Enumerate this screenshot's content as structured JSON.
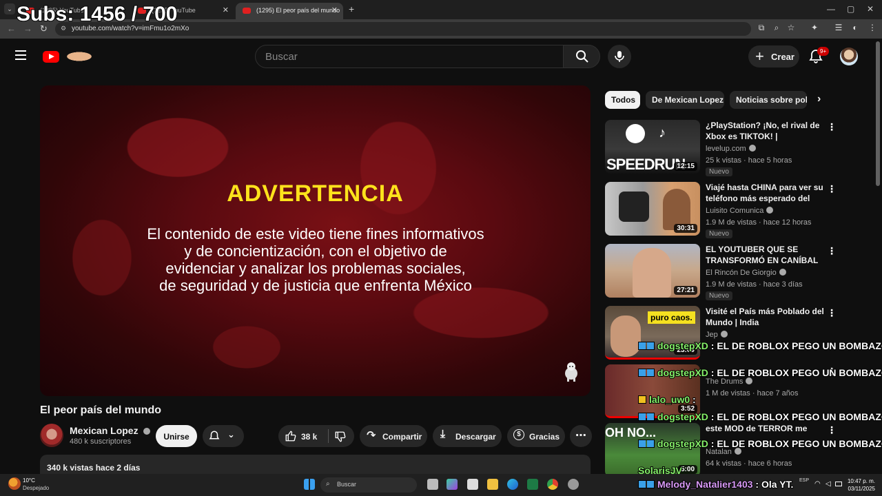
{
  "overlay": {
    "subs_counter": "Subs: 1456 / 700"
  },
  "browser": {
    "tabs": [
      {
        "label": "(1295) YouTube"
      },
      {
        "label": "(1295) YouTube"
      },
      {
        "label": "(1295) El peor país del mundo"
      }
    ],
    "new_tab": "+",
    "url": "youtube.com/watch?v=imFmu1o2mXo"
  },
  "header": {
    "search_placeholder": "Buscar",
    "create_label": "Crear",
    "notifications_badge": "9+"
  },
  "player": {
    "warning_title": "ADVERTENCIA",
    "warning_body": [
      "El contenido de este video tiene fines informativos",
      "y de concientización, con el objetivo de",
      "evidenciar y analizar los problemas sociales,",
      "de seguridad y de justicia que enfrenta México"
    ]
  },
  "video": {
    "title": "El peor país del mundo",
    "channel": "Mexican Lopez",
    "subscribers": "480 k suscriptores",
    "join_label": "Unirse",
    "likes": "38 k",
    "share_label": "Compartir",
    "download_label": "Descargar",
    "thanks_label": "Gracias",
    "views_date": "340 k vistas  hace 2 días"
  },
  "chips": [
    "Todos",
    "De Mexican Lopez",
    "Noticias sobre poli"
  ],
  "recommendations": [
    {
      "title": "¿PlayStation? ¡No, el rival de Xbox es TIKTOK! | SPEEDRUN",
      "channel": "levelup.com",
      "meta": "25 k vistas · hace 5 horas",
      "badge": "Nuevo",
      "duration": "12:15",
      "thumb_text": "SPEEDRUN"
    },
    {
      "title": "Viajé hasta CHINA para ver su teléfono más esperado del añ...",
      "channel": "Luisito Comunica",
      "meta": "1.9 M de vistas · hace 12 horas",
      "badge": "Nuevo",
      "duration": "30:31",
      "thumb_text": ""
    },
    {
      "title": "EL YOUTUBER QUE SE TRANSFORMÓ EN CANÍBAL ...",
      "channel": "El Rincón De Giorgio",
      "meta": "1.9 M de vistas · hace 3 días",
      "badge": "Nuevo",
      "duration": "27:21",
      "thumb_text": ""
    },
    {
      "title": "Visité el País más Poblado del Mundo | India",
      "channel": "Jep",
      "meta": "",
      "badge": "",
      "duration": "23:09",
      "thumb_text": "puro caos."
    },
    {
      "title": "",
      "channel": "The Drums",
      "meta": "1 M de vistas · hace 7 años",
      "badge": "",
      "duration": "3:52",
      "thumb_text": ""
    },
    {
      "title": "este MOD de TERROR me",
      "channel": "Natalan",
      "meta": "64 k vistas · hace 6 horas",
      "badge": "",
      "duration": "5:00",
      "thumb_text": "OH NO..."
    }
  ],
  "chat": [
    {
      "user": "dogstepXD",
      "msg": ": EL DE ROBLOX PEGO UN BOMBAZO"
    },
    {
      "user": "dogstepXD",
      "msg": ": EL DE ROBLOX PEGO UN BOMBAZO"
    },
    {
      "user": "lalo_uw0",
      "msg": ":"
    },
    {
      "user": "dogstepXD",
      "msg": ": EL DE ROBLOX PEGO UN BOMBAZO"
    },
    {
      "user": "dogstepXD",
      "msg": ": EL DE ROBLOX PEGO UN BOMBAZO"
    },
    {
      "user": "SolarisJV",
      "msg": ""
    },
    {
      "user": "Melody_Natalier1403",
      "msg": ": Ola YT."
    }
  ],
  "taskbar": {
    "temperature": "10°C",
    "condition": "Despejado",
    "search_label": "Buscar",
    "language": "ESP",
    "time": "10:47 p. m.",
    "date": "03/11/2025"
  },
  "colors": {
    "accent_red": "#ff0000",
    "warning_yellow": "#fde21c",
    "chat_user_green": "#86f06a",
    "chat_user_pink": "#d99af7"
  }
}
